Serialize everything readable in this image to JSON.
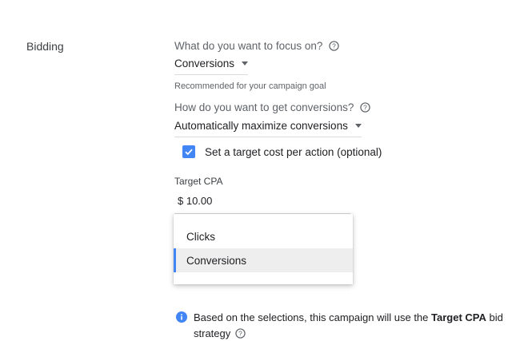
{
  "section": {
    "label": "Bidding"
  },
  "focus": {
    "question": "What do you want to focus on?",
    "selected": "Conversions",
    "note": "Recommended for your campaign goal"
  },
  "method": {
    "question": "How do you want to get conversions?",
    "selected": "Automatically maximize conversions"
  },
  "target_cpa_checkbox": {
    "label": "Set a target cost per action (optional)",
    "checked": true
  },
  "target_cpa": {
    "label": "Target CPA",
    "value": "$ 10.00"
  },
  "menu": {
    "items": [
      {
        "label": "Clicks",
        "selected": false
      },
      {
        "label": "Conversions",
        "selected": true
      }
    ]
  },
  "info": {
    "text_before": "Based on the selections, this campaign will use the ",
    "strategy": "Target CPA",
    "text_after": " bid strategy"
  },
  "colors": {
    "accent": "#4285f4",
    "info_icon": "#4285f4"
  }
}
